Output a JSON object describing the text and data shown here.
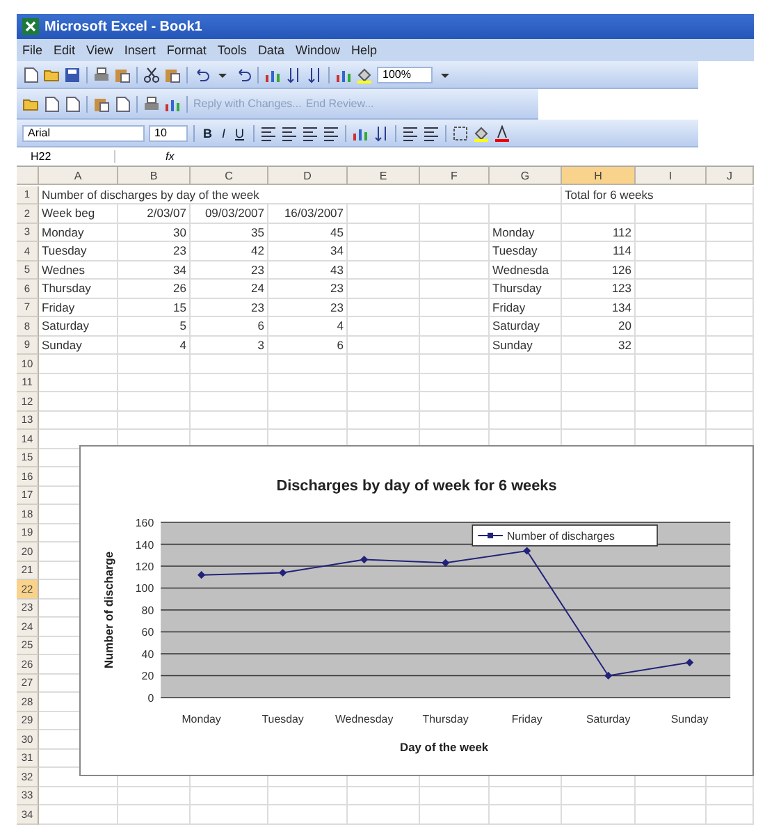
{
  "window": {
    "title": "Microsoft Excel - Book1"
  },
  "menu": [
    {
      "label": "File"
    },
    {
      "label": "Edit"
    },
    {
      "label": "View"
    },
    {
      "label": "Insert"
    },
    {
      "label": "Format"
    },
    {
      "label": "Tools"
    },
    {
      "label": "Data"
    },
    {
      "label": "Window"
    },
    {
      "label": "Help"
    }
  ],
  "standard_toolbar": {
    "zoom": "100%"
  },
  "reviewing_toolbar": {
    "actions": [
      {
        "label": "Reply with Changes...",
        "disabled": true
      },
      {
        "label": "End Review...",
        "disabled": true
      }
    ]
  },
  "formatting_toolbar": {
    "font": "Arial",
    "size": "10",
    "buttons": [
      {
        "label": "B",
        "kind": "bold"
      },
      {
        "label": "I",
        "kind": "italic"
      },
      {
        "label": "U",
        "kind": "underline"
      }
    ]
  },
  "formula_bar": {
    "name_box": "H22",
    "fx": "fx"
  },
  "sheet": {
    "columns": [
      {
        "label": "A",
        "selected": false
      },
      {
        "label": "B",
        "selected": false
      },
      {
        "label": "C",
        "selected": false
      },
      {
        "label": "D",
        "selected": false
      },
      {
        "label": "E",
        "selected": false
      },
      {
        "label": "F",
        "selected": false
      },
      {
        "label": "G",
        "selected": false
      },
      {
        "label": "H",
        "selected": true
      },
      {
        "label": "I",
        "selected": false
      },
      {
        "label": "J",
        "selected": false
      }
    ],
    "rows": [
      {
        "header": "1",
        "selected": false,
        "cells": [
          {
            "text": "Number of discharges by day of the week",
            "kind": "text"
          },
          null,
          null,
          null,
          null,
          null,
          null,
          {
            "text": "Total for 6 weeks",
            "kind": "text"
          }
        ]
      },
      {
        "header": "2",
        "selected": false,
        "cells": [
          {
            "text": "Week beg",
            "kind": "text"
          },
          {
            "text": "2/03/07",
            "kind": "number"
          },
          {
            "text": "09/03/2007",
            "kind": "number"
          },
          {
            "text": "16/03/2007",
            "kind": "number"
          }
        ]
      },
      {
        "header": "3",
        "selected": false,
        "cells": [
          {
            "text": "Monday",
            "kind": "text"
          },
          {
            "text": "30",
            "kind": "number"
          },
          {
            "text": "35",
            "kind": "number"
          },
          {
            "text": "45",
            "kind": "number"
          },
          null,
          null,
          {
            "text": "Monday",
            "kind": "text"
          },
          {
            "text": "112",
            "kind": "number"
          }
        ]
      },
      {
        "header": "4",
        "selected": false,
        "cells": [
          {
            "text": "Tuesday",
            "kind": "text"
          },
          {
            "text": "23",
            "kind": "number"
          },
          {
            "text": "42",
            "kind": "number"
          },
          {
            "text": "34",
            "kind": "number"
          },
          null,
          null,
          {
            "text": "Tuesday",
            "kind": "text"
          },
          {
            "text": "114",
            "kind": "number"
          }
        ]
      },
      {
        "header": "5",
        "selected": false,
        "cells": [
          {
            "text": "Wednes",
            "kind": "text"
          },
          {
            "text": "34",
            "kind": "number"
          },
          {
            "text": "23",
            "kind": "number"
          },
          {
            "text": "43",
            "kind": "number"
          },
          null,
          null,
          {
            "text": "Wednesda",
            "kind": "text"
          },
          {
            "text": "126",
            "kind": "number"
          }
        ]
      },
      {
        "header": "6",
        "selected": false,
        "cells": [
          {
            "text": "Thursday",
            "kind": "text"
          },
          {
            "text": "26",
            "kind": "number"
          },
          {
            "text": "24",
            "kind": "number"
          },
          {
            "text": "23",
            "kind": "number"
          },
          null,
          null,
          {
            "text": "Thursday",
            "kind": "text"
          },
          {
            "text": "123",
            "kind": "number"
          }
        ]
      },
      {
        "header": "7",
        "selected": false,
        "cells": [
          {
            "text": "Friday",
            "kind": "text"
          },
          {
            "text": "15",
            "kind": "number"
          },
          {
            "text": "23",
            "kind": "number"
          },
          {
            "text": "23",
            "kind": "number"
          },
          null,
          null,
          {
            "text": "Friday",
            "kind": "text"
          },
          {
            "text": "134",
            "kind": "number"
          }
        ]
      },
      {
        "header": "8",
        "selected": false,
        "cells": [
          {
            "text": "Saturday",
            "kind": "text"
          },
          {
            "text": "5",
            "kind": "number"
          },
          {
            "text": "6",
            "kind": "number"
          },
          {
            "text": "4",
            "kind": "number"
          },
          null,
          null,
          {
            "text": "Saturday",
            "kind": "text"
          },
          {
            "text": "20",
            "kind": "number"
          }
        ]
      },
      {
        "header": "9",
        "selected": false,
        "cells": [
          {
            "text": "Sunday",
            "kind": "text"
          },
          {
            "text": "4",
            "kind": "number"
          },
          {
            "text": "3",
            "kind": "number"
          },
          {
            "text": "6",
            "kind": "number"
          },
          null,
          null,
          {
            "text": "Sunday",
            "kind": "text"
          },
          {
            "text": "32",
            "kind": "number"
          }
        ]
      },
      {
        "header": "10",
        "selected": false
      },
      {
        "header": "11",
        "selected": false
      },
      {
        "header": "12",
        "selected": false
      },
      {
        "header": "13",
        "selected": false
      },
      {
        "header": "14",
        "selected": false
      },
      {
        "header": "15",
        "selected": false
      },
      {
        "header": "16",
        "selected": false
      },
      {
        "header": "17",
        "selected": false
      },
      {
        "header": "18",
        "selected": false
      },
      {
        "header": "19",
        "selected": false
      },
      {
        "header": "20",
        "selected": false
      },
      {
        "header": "21",
        "selected": false
      },
      {
        "header": "22",
        "selected": true
      },
      {
        "header": "23",
        "selected": false
      },
      {
        "header": "24",
        "selected": false
      },
      {
        "header": "25",
        "selected": false
      },
      {
        "header": "26",
        "selected": false
      },
      {
        "header": "27",
        "selected": false
      },
      {
        "header": "28",
        "selected": false
      },
      {
        "header": "29",
        "selected": false
      },
      {
        "header": "30",
        "selected": false
      },
      {
        "header": "31",
        "selected": false
      },
      {
        "header": "32",
        "selected": false
      },
      {
        "header": "33",
        "selected": false
      },
      {
        "header": "34",
        "selected": false
      }
    ]
  },
  "chart": {
    "chart_data": {
      "type": "line",
      "title": "Discharges by day of week for 6 weeks",
      "xlabel": "Day of the week",
      "ylabel": "Number of discharge",
      "categories": [
        "Monday",
        "Tuesday",
        "Wednesday",
        "Thursday",
        "Friday",
        "Saturday",
        "Sunday"
      ],
      "series": [
        {
          "name": "Number of discharges",
          "color": "#22227a",
          "marker": "diamond",
          "values": [
            112,
            114,
            126,
            123,
            134,
            20,
            32
          ]
        }
      ],
      "grid": true,
      "ylim": [
        0,
        160
      ],
      "yticks": [
        0,
        20,
        40,
        60,
        80,
        100,
        120,
        140,
        160
      ]
    }
  }
}
